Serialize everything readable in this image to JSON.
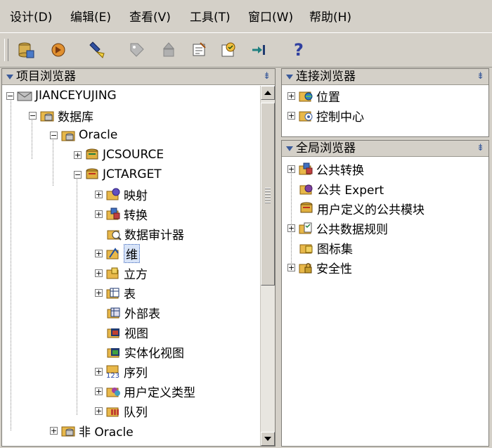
{
  "menubar": {
    "items": [
      "设计(D)",
      "编辑(E)",
      "查看(V)",
      "工具(T)",
      "窗口(W)",
      "帮助(H)"
    ]
  },
  "toolbar": {
    "buttons": [
      "database-icon",
      "wizard-icon",
      "flashlight-icon",
      "tag-icon",
      "deploy-icon",
      "properties-icon",
      "validate-icon",
      "goto-icon",
      "help-icon"
    ],
    "help_glyph": "?"
  },
  "project_browser": {
    "title": "项目浏览器",
    "nodes": [
      {
        "label": "JIANCEYUJING"
      },
      {
        "label": "数据库"
      },
      {
        "label": "Oracle"
      },
      {
        "label": "JCSOURCE"
      },
      {
        "label": "JCTARGET"
      },
      {
        "label": "映射"
      },
      {
        "label": "转换"
      },
      {
        "label": "数据审计器"
      },
      {
        "label": "维"
      },
      {
        "label": "立方"
      },
      {
        "label": "表"
      },
      {
        "label": "外部表"
      },
      {
        "label": "视图"
      },
      {
        "label": "实体化视图"
      },
      {
        "label": "序列",
        "icon_text": "123"
      },
      {
        "label": "用户定义类型"
      },
      {
        "label": "队列"
      },
      {
        "label": "非 Oracle"
      }
    ]
  },
  "connection_browser": {
    "title": "连接浏览器",
    "nodes": [
      {
        "label": "位置"
      },
      {
        "label": "控制中心"
      }
    ]
  },
  "global_browser": {
    "title": "全局浏览器",
    "nodes": [
      {
        "label": "公共转换"
      },
      {
        "label": "公共 Expert"
      },
      {
        "label": "用户定义的公共模块"
      },
      {
        "label": "公共数据规则"
      },
      {
        "label": "图标集"
      },
      {
        "label": "安全性"
      }
    ]
  },
  "colors": {
    "chrome": "#d4d0c8",
    "accent_blue": "#3a5a9a",
    "folder": "#e8b84a",
    "selection": "#d8e4f8"
  }
}
